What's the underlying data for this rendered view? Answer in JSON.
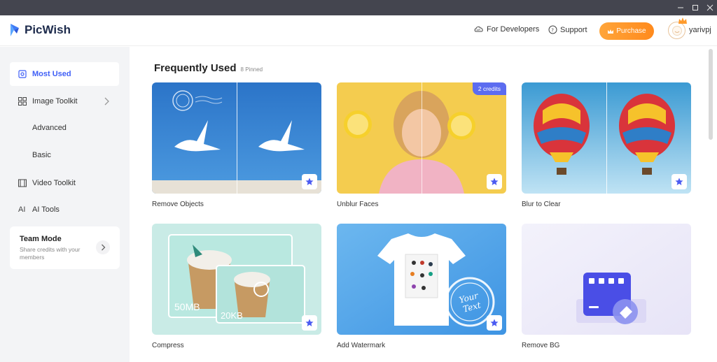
{
  "app": {
    "name": "PicWish",
    "colors": {
      "brand": "#3f5ff6",
      "purchase": "#ff9a2a",
      "star": "#4b5bf2",
      "titlebar": "#44454f"
    }
  },
  "header": {
    "developers": "For Developers",
    "support": "Support",
    "purchase": "Purchase",
    "username": "yarivpj"
  },
  "sidebar": {
    "most_used": "Most Used",
    "image_toolkit": "Image Toolkit",
    "advanced": "Advanced",
    "basic": "Basic",
    "video_toolkit": "Video Toolkit",
    "ai_tools": "AI Tools",
    "ai_icon": "AI",
    "team_mode": {
      "title": "Team Mode",
      "subtitle": "Share credits with your members"
    }
  },
  "main": {
    "title": "Frequently Used",
    "subtitle": "8 Pinned",
    "cards": [
      {
        "label": "Remove Objects"
      },
      {
        "label": "Unblur Faces",
        "badge": "2 credits"
      },
      {
        "label": "Blur to Clear"
      },
      {
        "label": "Compress",
        "size_before": "50MB",
        "size_after": "20KB"
      },
      {
        "label": "Add Watermark",
        "stamp_text": "Your Text"
      },
      {
        "label": "Remove BG"
      }
    ]
  }
}
